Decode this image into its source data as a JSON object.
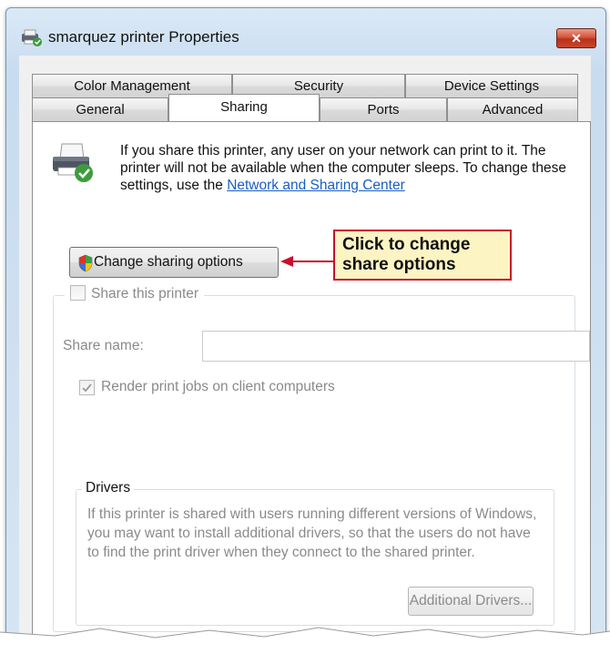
{
  "window": {
    "title": "smarquez printer Properties",
    "close_label": "✕"
  },
  "tabs": {
    "row1": [
      {
        "label": "Color Management"
      },
      {
        "label": "Security"
      },
      {
        "label": "Device Settings"
      }
    ],
    "row2": [
      {
        "label": "General"
      },
      {
        "label": "Sharing",
        "active": true
      },
      {
        "label": "Ports"
      },
      {
        "label": "Advanced"
      }
    ]
  },
  "sharing": {
    "info_text": "If you share this printer, any user on your network can print to it. The printer will not be available when the computer sleeps. To change these settings, use the",
    "info_link": "Network and Sharing Center",
    "change_button": "Change sharing options",
    "callout": "Click to change share options",
    "share_checkbox_label": "Share this printer",
    "share_checkbox_checked": false,
    "share_name_label": "Share name:",
    "share_name_value": "",
    "render_label": "Render print jobs on client computers",
    "render_checked": true
  },
  "drivers": {
    "legend": "Drivers",
    "text": "If this printer is shared with users running different versions of Windows, you may want to install additional drivers, so that the users do not have to find the print driver when they connect to the shared printer.",
    "button": "Additional Drivers..."
  },
  "colors": {
    "callout_border": "#c8102e",
    "callout_fill": "#fdf4c3",
    "link": "#1a5ec2",
    "close": "#c9452a"
  }
}
